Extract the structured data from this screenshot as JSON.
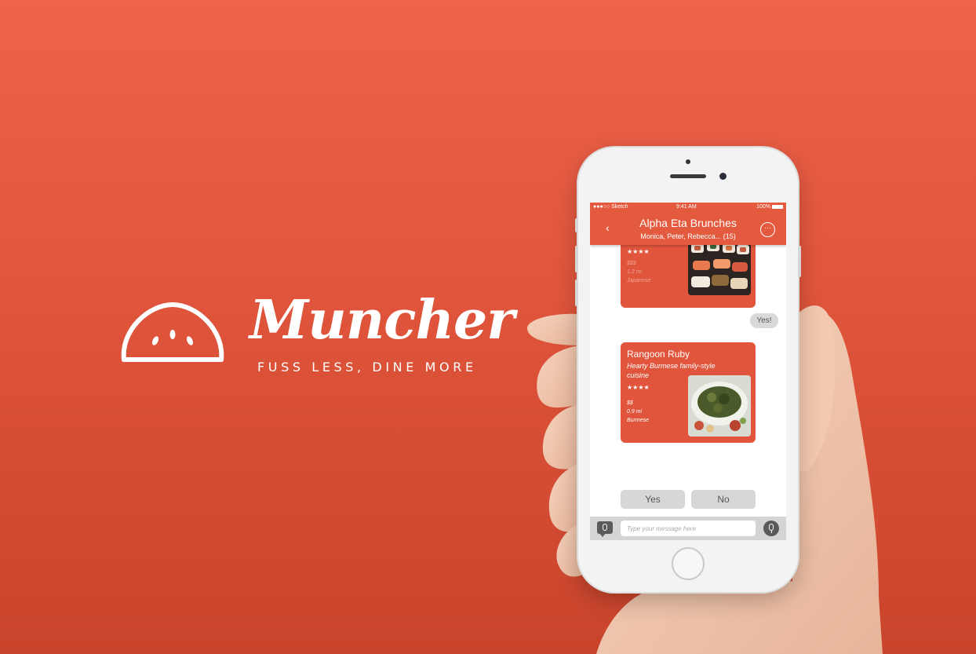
{
  "brand": {
    "name": "Muncher",
    "tagline": "FUSS LESS, DINE MORE"
  },
  "status_bar": {
    "carrier": "●●●○○ Sketch",
    "time": "9:41 AM",
    "battery": "100%"
  },
  "chat": {
    "title": "Alpha Eta Brunches",
    "members": "Monica, Peter, Rebecca... (15)",
    "back_icon": "chevron-left-icon",
    "more_icon": "more-options-icon"
  },
  "messages": [
    {
      "type": "restaurant_card",
      "stars": "★★★★",
      "price": "$$$",
      "distance": "1.2 mi",
      "cuisine": "Japanese",
      "image": "sushi-photo"
    },
    {
      "type": "user_reply",
      "text": "Yes!"
    },
    {
      "type": "restaurant_card",
      "name": "Rangoon Ruby",
      "description": "Hearty Burmese family-style cuisine",
      "stars": "★★★★",
      "price": "$$",
      "distance": "0.9 mi",
      "cuisine": "Burmese",
      "image": "burmese-salad-photo"
    }
  ],
  "quick_replies": {
    "yes": "Yes",
    "no": "No"
  },
  "composer": {
    "placeholder": "Type your message here"
  },
  "colors": {
    "background": "#e0553c",
    "nav_bar": "#e45a3e",
    "card": "#e1553c"
  }
}
